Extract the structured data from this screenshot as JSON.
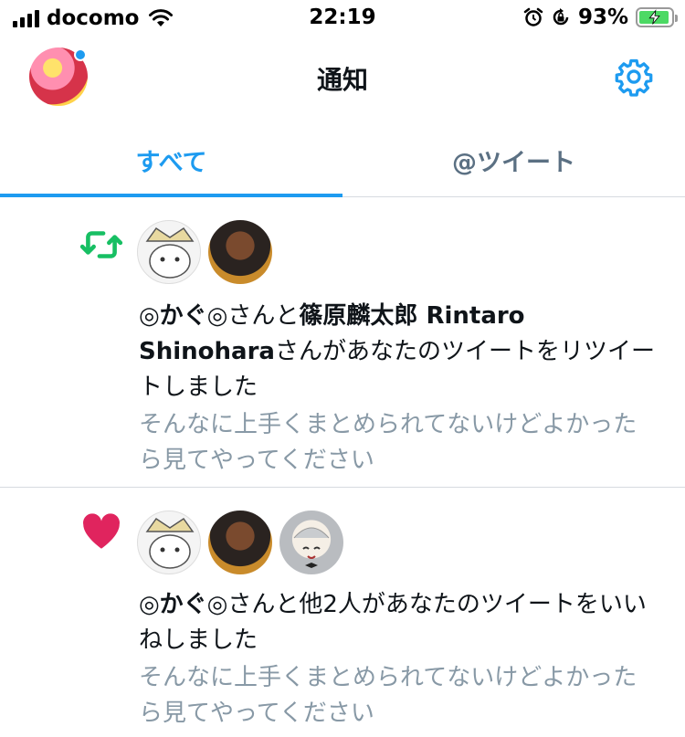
{
  "status_bar": {
    "carrier": "docomo",
    "time": "22:19",
    "battery_percent": "93%",
    "battery_level": 0.93,
    "icons": [
      "signal-icon",
      "wifi-icon",
      "alarm-icon",
      "rotation-lock-icon",
      "battery-icon"
    ]
  },
  "header": {
    "title": "通知",
    "settings_icon": "gear-icon"
  },
  "tabs": [
    {
      "label": "すべて",
      "active": true
    },
    {
      "label": "@ツイート",
      "active": false
    }
  ],
  "notifications": [
    {
      "type": "retweet",
      "icon": "retweet-icon",
      "name1": "◎かぐ◎",
      "mid": "さんと",
      "name2": "篠原麟太郎 Rintaro Shinohara",
      "suffix": "さんがあなたのツイートをリツイートしました",
      "preview": "そんなに上手くまとめられてないけどよかったら見てやってください"
    },
    {
      "type": "like",
      "icon": "heart-icon",
      "name1": "◎かぐ◎",
      "suffix": "さんと他2人があなたのツイートをいいねしました",
      "preview": "そんなに上手くまとめられてないけどよかったら見てやってください"
    }
  ],
  "colors": {
    "accent": "#1d9bf0",
    "retweet": "#17bf63",
    "like": "#e0245e",
    "secondary_text": "#8899a6"
  }
}
